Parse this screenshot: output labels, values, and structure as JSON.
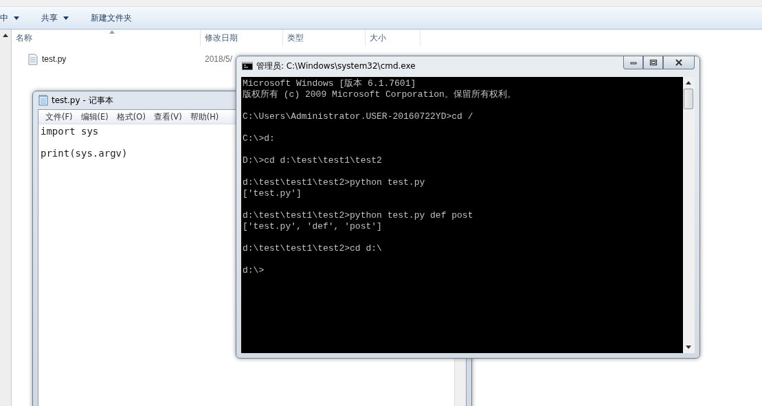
{
  "explorer": {
    "toolbar": [
      {
        "label": "中",
        "dropdown": true
      },
      {
        "label": "共享",
        "dropdown": true
      },
      {
        "label": "新建文件夹",
        "dropdown": false
      }
    ],
    "columns": [
      "名称",
      "修改日期",
      "类型",
      "大小"
    ],
    "files": [
      {
        "name": "test.py",
        "modified": "2018/5/"
      }
    ]
  },
  "notepad": {
    "title": "test.py - 记事本",
    "menu": [
      "文件(F)",
      "编辑(E)",
      "格式(O)",
      "查看(V)",
      "帮助(H)"
    ],
    "blocks": [
      [
        "import sys"
      ],
      [
        "print(sys.argv)"
      ]
    ]
  },
  "console": {
    "title": "管理员: C:\\Windows\\system32\\cmd.exe",
    "blocks": [
      [
        "Microsoft Windows [版本 6.1.7601]",
        "版权所有 (c) 2009 Microsoft Corporation。保留所有权利。"
      ],
      [
        "C:\\Users\\Administrator.USER-20160722YD>cd /"
      ],
      [
        "C:\\>d:"
      ],
      [
        "D:\\>cd d:\\test\\test1\\test2"
      ],
      [
        "d:\\test\\test1\\test2>python test.py",
        "['test.py']"
      ],
      [
        "d:\\test\\test1\\test2>python test.py def post",
        "['test.py', 'def', 'post']"
      ],
      [
        "d:\\test\\test1\\test2>cd d:\\"
      ],
      [
        "d:\\>"
      ]
    ]
  }
}
